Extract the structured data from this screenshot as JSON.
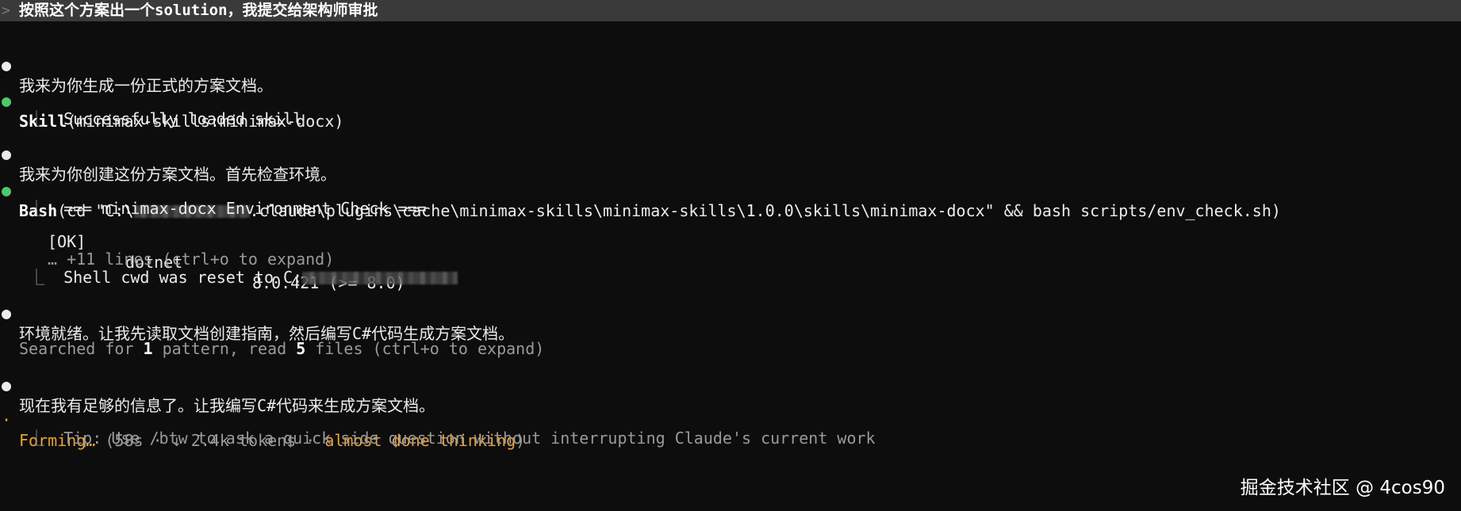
{
  "prompt": {
    "caret": ">",
    "command": "按照这个方案出一个solution，我提交给架构师审批"
  },
  "lines": {
    "intro": "我来为你生成一份正式的方案文档。",
    "skill_name": "Skill",
    "skill_args": "(minimax-skills:minimax-docx)",
    "skill_result": "Successfully loaded skill",
    "create_doc": "我来为你创建这份方案文档。首先检查环境。",
    "bash_name": "Bash",
    "bash_prefix": "(cd \"C:\\",
    "bash_suffix": ".claude\\plugins\\cache\\minimax-skills\\minimax-skills\\1.0.0\\skills\\minimax-docx\" && bash scripts/env_check.sh)",
    "env_check_header": "=== minimax-docx Environment Check ===",
    "ok_status": "[OK]",
    "ok_name": "dotnet",
    "ok_version": "8.0.421 (>= 8.0)",
    "more_lines": "… +11 lines (ctrl+o to expand)",
    "cwd_reset": "Shell cwd was reset to C:",
    "env_ready": "环境就绪。让我先读取文档创建指南，然后编写C#代码生成方案文档。",
    "searched_pre": "Searched for ",
    "searched_count": "1",
    "searched_mid": " pattern, read ",
    "read_count": "5",
    "searched_post": " files (ctrl+o to expand)",
    "enough_info": "现在我有足够的信息了。让我编写C#代码来生成方案文档。",
    "forming": "Forming…",
    "forming_stats": " (58s · ↓ 2.4k tokens · ",
    "thinking_state": "almost done thinking",
    "forming_close": ")",
    "tip": "Tip: Use /btw to ask a quick side question without interrupting Claude's current work"
  },
  "glyphs": {
    "bullet": "●",
    "tree": "⎿",
    "spinner": "·"
  },
  "watermark": "掘金技术社区 @ 4cos90",
  "colors": {
    "background": "#0d0d0d",
    "prompt_bar": "#3a3a3a",
    "success_green": "#4ec96a",
    "spinner_orange": "#e8a33a",
    "dim_text": "#9a9a9a"
  }
}
